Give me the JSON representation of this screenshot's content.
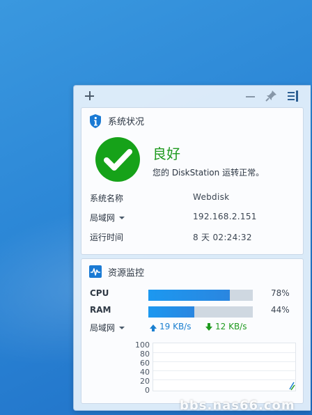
{
  "widget": {
    "system_health": {
      "title": "系统状况",
      "status": "良好",
      "description": "您的 DiskStation 运转正常。",
      "rows": [
        {
          "label": "系统名称",
          "value": "Webdisk"
        },
        {
          "label": "局域网",
          "value": "192.168.2.151"
        },
        {
          "label": "运行时间",
          "value": "8 天 02:24:32"
        }
      ]
    },
    "resource_monitor": {
      "title": "资源监控",
      "cpu": {
        "label": "CPU",
        "percent": 78,
        "percent_text": "78%"
      },
      "ram": {
        "label": "RAM",
        "percent": 44,
        "percent_text": "44%"
      },
      "network": {
        "label": "局域网",
        "upload": "19 KB/s",
        "download": "12 KB/s"
      },
      "chart_ticks": [
        "100",
        "80",
        "60",
        "40",
        "20",
        "0"
      ]
    }
  },
  "watermark": "bbs.nas66.com",
  "colors": {
    "accent": "#1c98f0",
    "healthy": "#16a219",
    "upload": "#1a7fd0",
    "download": "#1f9a1f"
  },
  "icons": [
    "plus-icon",
    "minimize-icon",
    "pin-icon",
    "sidebar-icon",
    "info-shield-icon",
    "check-icon",
    "monitor-icon",
    "chevron-down-icon",
    "arrow-up-icon",
    "arrow-down-icon"
  ]
}
